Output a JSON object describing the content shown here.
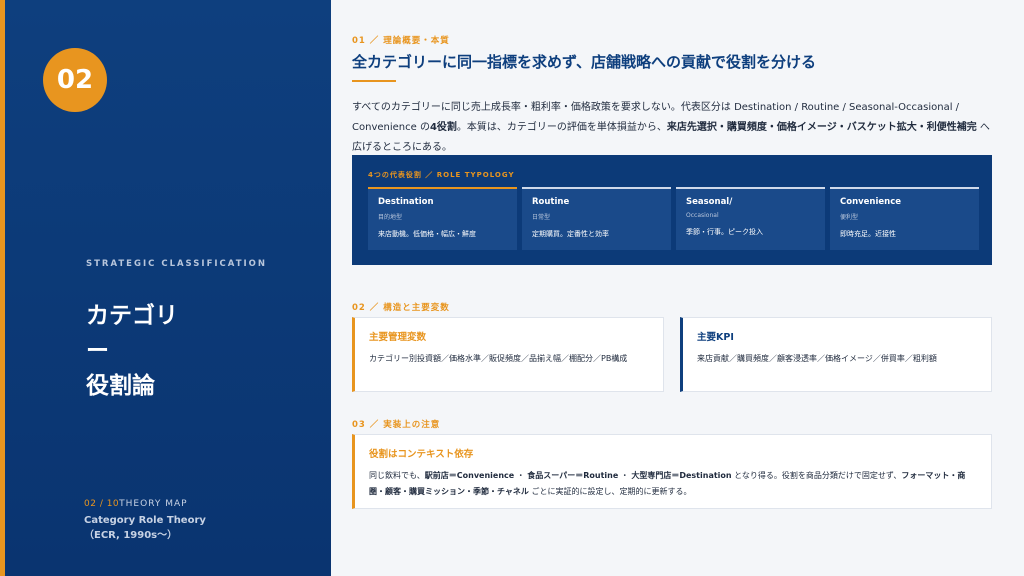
{
  "left": {
    "number": "02",
    "eyebrow": "STRATEGIC CLASSIFICATION",
    "title_line1": "カテゴリ",
    "title_line2": "ー",
    "title_line3": "役割論",
    "page_counter": "02 / 10",
    "page_label": "THEORY MAP",
    "theory_name": "Category Role Theory",
    "theory_origin": "（ECR, 1990s〜）"
  },
  "section1": {
    "label": "01 ／ 理論概要・本質",
    "headline": "全カテゴリーに同一指標を求めず、店舗戦略への貢献で役割を分ける",
    "para_a": "すべてのカテゴリーに同じ売上成長率・粗利率・価格政策を要求しない。代表区分は Destination / Routine / Seasonal-Occasional / Convenience の",
    "para_b": "4役割",
    "para_c": "。本質は、カテゴリーの評価を単体損益から、",
    "para_d": "来店先選択・購買頻度・価格イメージ・バスケット拡大・利便性補完",
    "para_e": " へ広げるところにある。"
  },
  "typology": {
    "label": "4つの代表役割 ／ ROLE TYPOLOGY",
    "cards": [
      {
        "name": "Destination",
        "sub": "目的地型",
        "desc": "来店動機。低価格・幅広・鮮度"
      },
      {
        "name": "Routine",
        "sub": "日常型",
        "desc": "定期購買。定番性と効率"
      },
      {
        "name": "Seasonal/",
        "sub": "Occasional",
        "desc": "季節・行事。ピーク投入"
      },
      {
        "name": "Convenience",
        "sub": "便利型",
        "desc": "即時充足。近接性"
      }
    ]
  },
  "section2": {
    "label": "02 ／ 構造と主要変数",
    "box1_title": "主要管理変数",
    "box1_text": "カテゴリー別投資額／価格水準／販促頻度／品揃え幅／棚配分／PB構成",
    "box2_title": "主要KPI",
    "box2_text": "来店貢献／購買頻度／顧客浸透率／価格イメージ／併買率／粗利額"
  },
  "section3": {
    "label": "03 ／ 実装上の注意",
    "box_title": "役割はコンテキスト依存",
    "t1": "同じ飲料でも、",
    "t2": "駅前店＝Convenience",
    "t3": " ・ ",
    "t4": "食品スーパー＝Routine",
    "t5": " ・ ",
    "t6": "大型専門店＝Destination",
    "t7": " となり得る。役割を商品分類だけで固定せず、",
    "t8": "フォーマット・商圏・顧客・購買ミッション・季節・チャネル",
    "t9": " ごとに実証的に設定し、定期的に更新する。"
  },
  "colors": {
    "navy": "#0e3f7e",
    "orange": "#e8951f",
    "background": "#f4f6f9"
  }
}
